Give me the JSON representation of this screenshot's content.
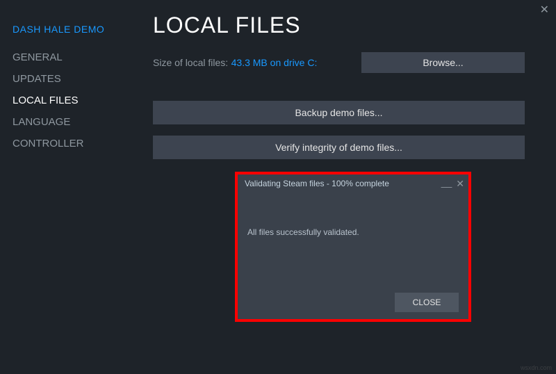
{
  "window": {
    "close_glyph": "✕"
  },
  "sidebar": {
    "title": "DASH HALE DEMO",
    "items": [
      {
        "label": "GENERAL"
      },
      {
        "label": "UPDATES"
      },
      {
        "label": "LOCAL FILES"
      },
      {
        "label": "LANGUAGE"
      },
      {
        "label": "CONTROLLER"
      }
    ]
  },
  "main": {
    "title": "LOCAL FILES",
    "size_label": "Size of local files:",
    "size_value": "43.3 MB on drive C:",
    "browse_label": "Browse...",
    "backup_label": "Backup demo files...",
    "verify_label": "Verify integrity of demo files..."
  },
  "dialog": {
    "title": "Validating Steam files - 100% complete",
    "body": "All files successfully validated.",
    "minimize_glyph": "__",
    "close_glyph": "✕",
    "close_button": "CLOSE"
  },
  "watermark": "wsxdn.com"
}
